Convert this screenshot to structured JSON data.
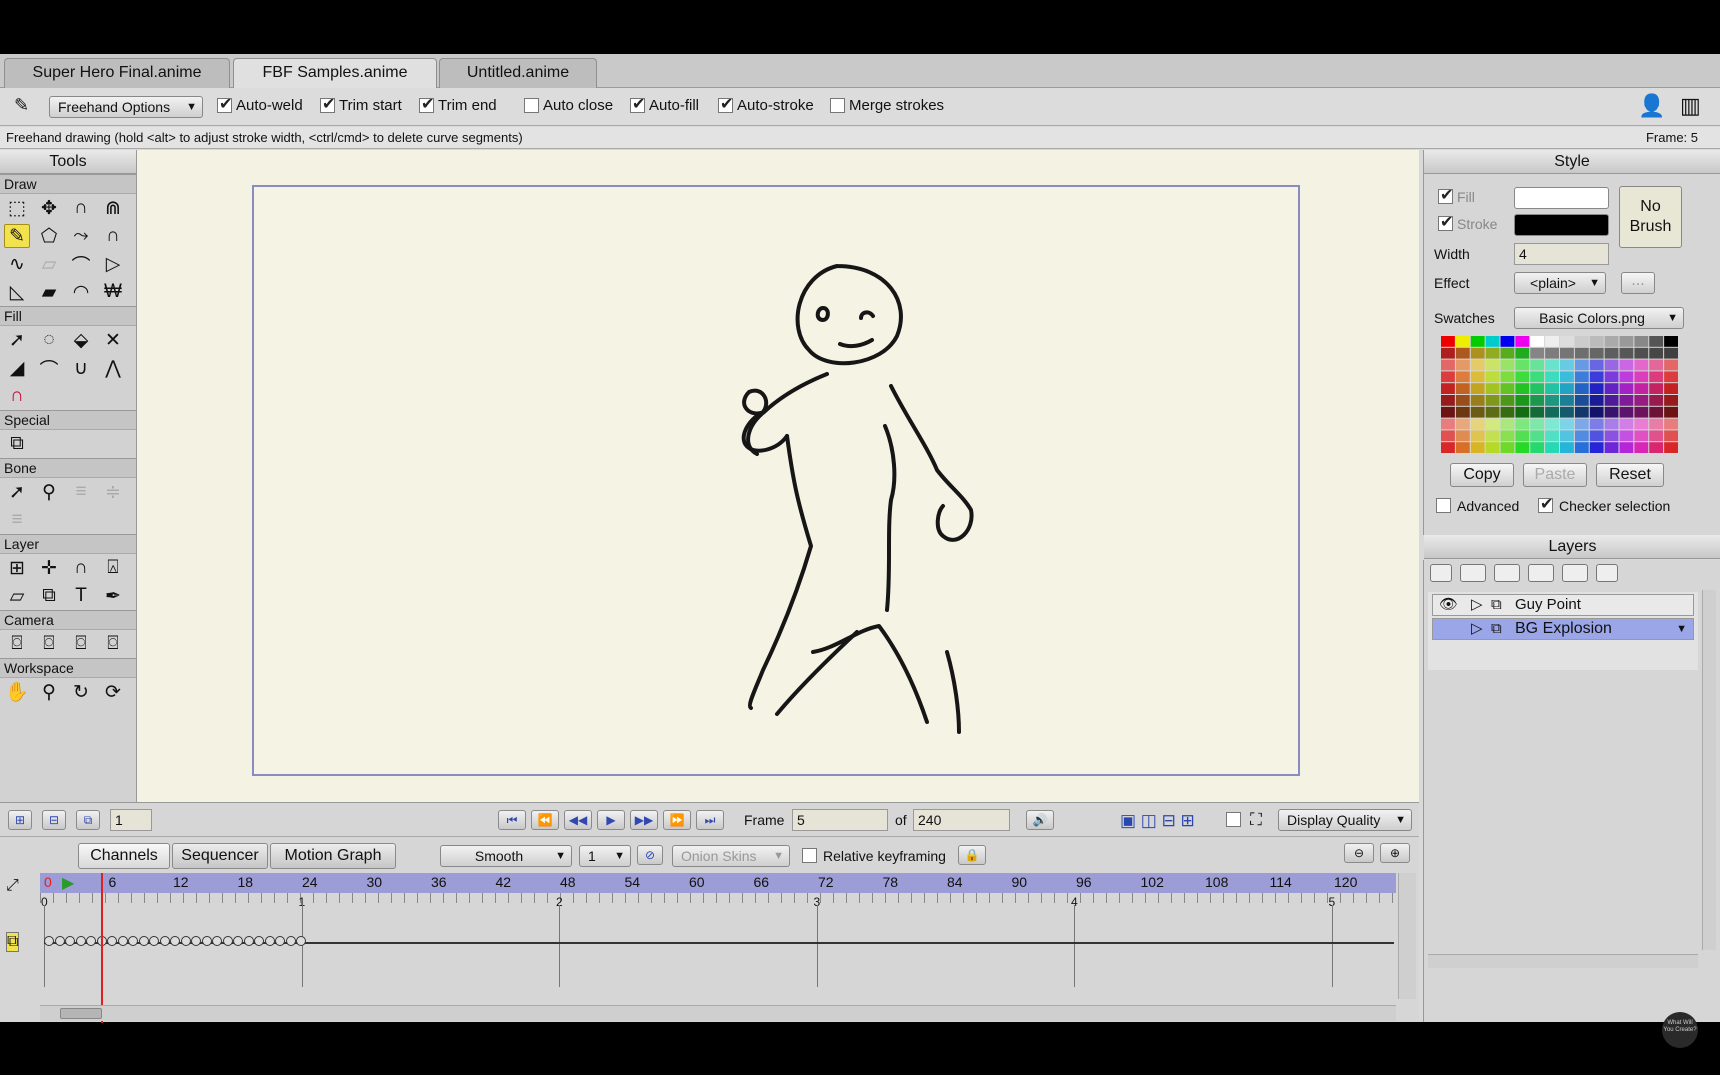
{
  "tabs": [
    "Super Hero Final.anime",
    "FBF Samples.anime",
    "Untitled.anime"
  ],
  "toolbar": {
    "freehand_options": "Freehand Options",
    "auto_weld": "Auto-weld",
    "trim_start": "Trim start",
    "trim_end": "Trim end",
    "auto_close": "Auto close",
    "auto_fill": "Auto-fill",
    "auto_stroke": "Auto-stroke",
    "merge_strokes": "Merge strokes"
  },
  "status": {
    "hint": "Freehand drawing (hold <alt> to adjust stroke width, <ctrl/cmd> to delete curve segments)",
    "frame": "Frame: 5"
  },
  "tools": {
    "title": "Tools",
    "sections": [
      "Draw",
      "Fill",
      "Special",
      "Bone",
      "Layer",
      "Camera",
      "Workspace"
    ]
  },
  "style": {
    "title": "Style",
    "fill": "Fill",
    "stroke": "Stroke",
    "width": "Width",
    "width_value": "4",
    "effect": "Effect",
    "effect_value": "<plain>",
    "more": "...",
    "no_brush": "No Brush",
    "swatches": "Swatches",
    "swatches_value": "Basic Colors.png",
    "copy": "Copy",
    "paste": "Paste",
    "reset": "Reset",
    "advanced": "Advanced",
    "checker": "Checker selection",
    "fill_color": "#ffffff",
    "stroke_color": "#000000"
  },
  "layers": {
    "title": "Layers",
    "items": [
      {
        "name": "Guy Point"
      },
      {
        "name": "BG Explosion"
      }
    ]
  },
  "playbar": {
    "layer_field": "1",
    "frame_label": "Frame",
    "frame_value": "5",
    "of_label": "of",
    "total": "240",
    "display_quality": "Display Quality"
  },
  "timeline": {
    "tabs": [
      "Channels",
      "Sequencer",
      "Motion Graph"
    ],
    "interp": "Smooth",
    "step": "1",
    "onion": "Onion Skins",
    "relative": "Relative keyframing",
    "ruler": [
      "0",
      "6",
      "12",
      "18",
      "24",
      "30",
      "36",
      "42",
      "48",
      "54",
      "60",
      "66",
      "72",
      "78",
      "84",
      "90",
      "96",
      "102",
      "108",
      "114",
      "120"
    ],
    "seconds": [
      "0",
      "1",
      "2",
      "3",
      "4",
      "5"
    ]
  },
  "watermark": "What Will You Create?"
}
